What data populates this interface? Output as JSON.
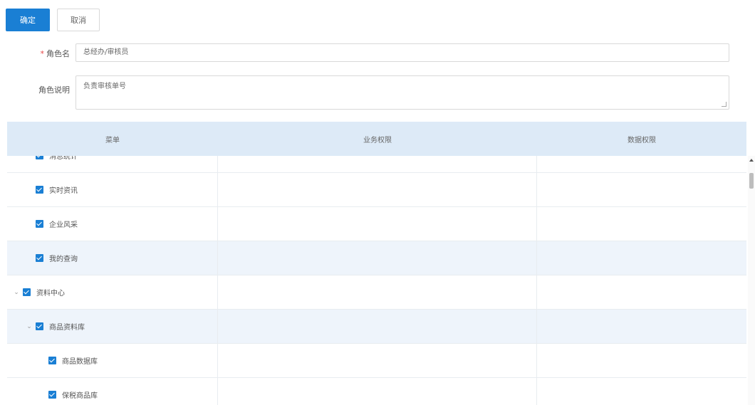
{
  "actions": {
    "confirm_label": "确定",
    "cancel_label": "取消"
  },
  "form": {
    "role_name_required_mark": "*",
    "role_name_label": "角色名",
    "role_name_value": "总经办/审核员",
    "role_desc_label": "角色说明",
    "role_desc_value": "负责审核单号"
  },
  "table": {
    "headers": [
      "菜单",
      "业务权限",
      "数据权限"
    ],
    "rows": [
      {
        "indent": 1,
        "caret": "",
        "label": "消息统计"
      },
      {
        "indent": 1,
        "caret": "",
        "label": "实时资讯"
      },
      {
        "indent": 1,
        "caret": "",
        "label": "企业风采"
      },
      {
        "indent": 1,
        "caret": "",
        "label": "我的查询"
      },
      {
        "indent": 0,
        "caret": "⌄",
        "label": "资料中心"
      },
      {
        "indent": 1,
        "caret": "⌄",
        "label": "商品资料库"
      },
      {
        "indent": 2,
        "caret": "",
        "label": "商品数据库"
      },
      {
        "indent": 2,
        "caret": "",
        "label": "保税商品库"
      }
    ]
  },
  "colors": {
    "primary": "#1a7fd4",
    "header_bg": "#ddeaf7",
    "row_highlight": "#eef4fb",
    "required": "#e64545"
  }
}
